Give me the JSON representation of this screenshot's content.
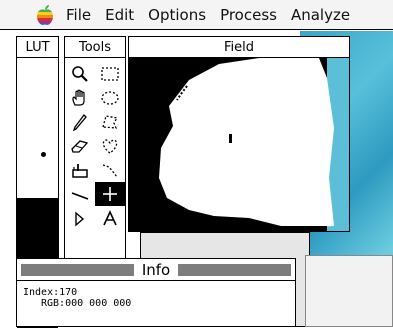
{
  "menubar": {
    "apple_icon": "apple-icon",
    "items": [
      "File",
      "Edit",
      "Options",
      "Process",
      "Analyze"
    ]
  },
  "windows": {
    "lut": {
      "title": "LUT"
    },
    "tools": {
      "title": "Tools",
      "items": [
        {
          "name": "magnifier-tool-icon"
        },
        {
          "name": "rect-select-tool-icon"
        },
        {
          "name": "hand-tool-icon"
        },
        {
          "name": "oval-select-tool-icon"
        },
        {
          "name": "pencil-tool-icon"
        },
        {
          "name": "polygon-select-tool-icon"
        },
        {
          "name": "eraser-tool-icon"
        },
        {
          "name": "freehand-select-tool-icon"
        },
        {
          "name": "paint-bucket-tool-icon"
        },
        {
          "name": "wand-tool-icon"
        },
        {
          "name": "line-tool-icon"
        },
        {
          "name": "crosshair-tool-icon",
          "selected": true
        },
        {
          "name": "arrow-tool-icon"
        },
        {
          "name": "text-tool-icon"
        }
      ]
    },
    "field": {
      "title": "Field"
    },
    "info": {
      "title": "Info",
      "index_line": "Index:170",
      "rgb_line": "RGB:000 000 000"
    }
  },
  "colors": {
    "desktop": "#3aa6c9",
    "info_bar": "#7d7d7d"
  }
}
